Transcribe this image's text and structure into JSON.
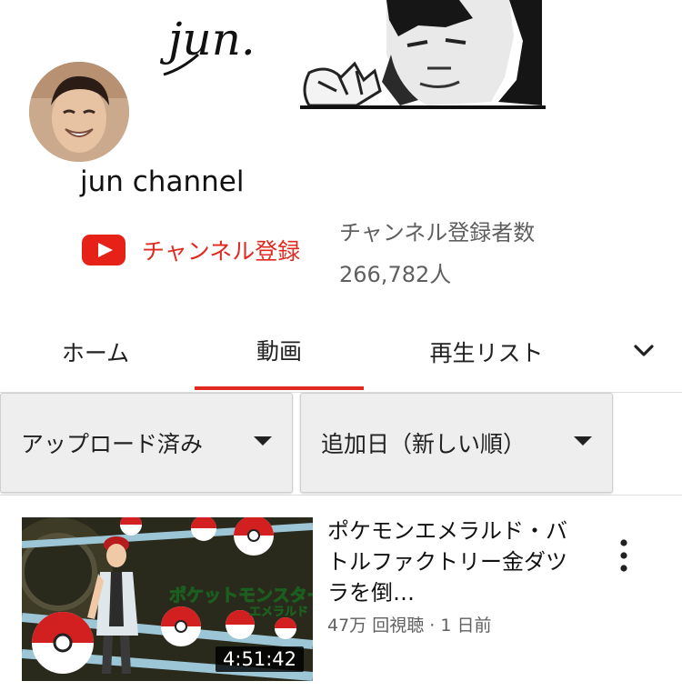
{
  "banner": {
    "signature": "jun."
  },
  "channel": {
    "name": "jun channel",
    "subscribe_label": "チャンネル登録",
    "subscriber_label": "チャンネル登録者数",
    "subscriber_count": "266,782人"
  },
  "tabs": [
    {
      "label": "ホーム",
      "active": false
    },
    {
      "label": "動画",
      "active": true
    },
    {
      "label": "再生リスト",
      "active": false
    }
  ],
  "filters": {
    "sort_left": "アップロード済み",
    "sort_right": "追加日（新しい順）"
  },
  "videos": [
    {
      "title": "ポケモンエメラルド・バトルファクトリー金ダツラを倒…",
      "meta": "47万 回視聴 · 1 日前",
      "duration": "4:51:42",
      "thumb_logo_top": "ポケットモンスター",
      "thumb_logo_bottom": "エメラルド"
    }
  ],
  "colors": {
    "accent": "#e02a20",
    "youtube_red": "#e62117",
    "secondary_text": "#5f5f5f"
  }
}
